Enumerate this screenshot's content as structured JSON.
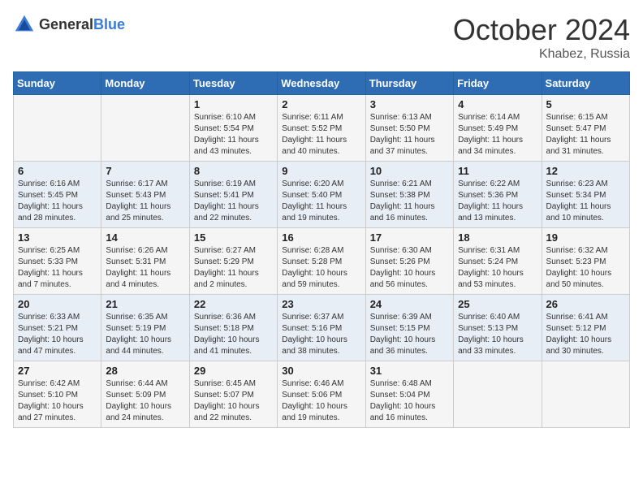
{
  "header": {
    "logo_general": "General",
    "logo_blue": "Blue",
    "month": "October 2024",
    "location": "Khabez, Russia"
  },
  "days_of_week": [
    "Sunday",
    "Monday",
    "Tuesday",
    "Wednesday",
    "Thursday",
    "Friday",
    "Saturday"
  ],
  "weeks": [
    [
      {
        "date": "",
        "info": ""
      },
      {
        "date": "",
        "info": ""
      },
      {
        "date": "1",
        "info": "Sunrise: 6:10 AM\nSunset: 5:54 PM\nDaylight: 11 hours and 43 minutes."
      },
      {
        "date": "2",
        "info": "Sunrise: 6:11 AM\nSunset: 5:52 PM\nDaylight: 11 hours and 40 minutes."
      },
      {
        "date": "3",
        "info": "Sunrise: 6:13 AM\nSunset: 5:50 PM\nDaylight: 11 hours and 37 minutes."
      },
      {
        "date": "4",
        "info": "Sunrise: 6:14 AM\nSunset: 5:49 PM\nDaylight: 11 hours and 34 minutes."
      },
      {
        "date": "5",
        "info": "Sunrise: 6:15 AM\nSunset: 5:47 PM\nDaylight: 11 hours and 31 minutes."
      }
    ],
    [
      {
        "date": "6",
        "info": "Sunrise: 6:16 AM\nSunset: 5:45 PM\nDaylight: 11 hours and 28 minutes."
      },
      {
        "date": "7",
        "info": "Sunrise: 6:17 AM\nSunset: 5:43 PM\nDaylight: 11 hours and 25 minutes."
      },
      {
        "date": "8",
        "info": "Sunrise: 6:19 AM\nSunset: 5:41 PM\nDaylight: 11 hours and 22 minutes."
      },
      {
        "date": "9",
        "info": "Sunrise: 6:20 AM\nSunset: 5:40 PM\nDaylight: 11 hours and 19 minutes."
      },
      {
        "date": "10",
        "info": "Sunrise: 6:21 AM\nSunset: 5:38 PM\nDaylight: 11 hours and 16 minutes."
      },
      {
        "date": "11",
        "info": "Sunrise: 6:22 AM\nSunset: 5:36 PM\nDaylight: 11 hours and 13 minutes."
      },
      {
        "date": "12",
        "info": "Sunrise: 6:23 AM\nSunset: 5:34 PM\nDaylight: 11 hours and 10 minutes."
      }
    ],
    [
      {
        "date": "13",
        "info": "Sunrise: 6:25 AM\nSunset: 5:33 PM\nDaylight: 11 hours and 7 minutes."
      },
      {
        "date": "14",
        "info": "Sunrise: 6:26 AM\nSunset: 5:31 PM\nDaylight: 11 hours and 4 minutes."
      },
      {
        "date": "15",
        "info": "Sunrise: 6:27 AM\nSunset: 5:29 PM\nDaylight: 11 hours and 2 minutes."
      },
      {
        "date": "16",
        "info": "Sunrise: 6:28 AM\nSunset: 5:28 PM\nDaylight: 10 hours and 59 minutes."
      },
      {
        "date": "17",
        "info": "Sunrise: 6:30 AM\nSunset: 5:26 PM\nDaylight: 10 hours and 56 minutes."
      },
      {
        "date": "18",
        "info": "Sunrise: 6:31 AM\nSunset: 5:24 PM\nDaylight: 10 hours and 53 minutes."
      },
      {
        "date": "19",
        "info": "Sunrise: 6:32 AM\nSunset: 5:23 PM\nDaylight: 10 hours and 50 minutes."
      }
    ],
    [
      {
        "date": "20",
        "info": "Sunrise: 6:33 AM\nSunset: 5:21 PM\nDaylight: 10 hours and 47 minutes."
      },
      {
        "date": "21",
        "info": "Sunrise: 6:35 AM\nSunset: 5:19 PM\nDaylight: 10 hours and 44 minutes."
      },
      {
        "date": "22",
        "info": "Sunrise: 6:36 AM\nSunset: 5:18 PM\nDaylight: 10 hours and 41 minutes."
      },
      {
        "date": "23",
        "info": "Sunrise: 6:37 AM\nSunset: 5:16 PM\nDaylight: 10 hours and 38 minutes."
      },
      {
        "date": "24",
        "info": "Sunrise: 6:39 AM\nSunset: 5:15 PM\nDaylight: 10 hours and 36 minutes."
      },
      {
        "date": "25",
        "info": "Sunrise: 6:40 AM\nSunset: 5:13 PM\nDaylight: 10 hours and 33 minutes."
      },
      {
        "date": "26",
        "info": "Sunrise: 6:41 AM\nSunset: 5:12 PM\nDaylight: 10 hours and 30 minutes."
      }
    ],
    [
      {
        "date": "27",
        "info": "Sunrise: 6:42 AM\nSunset: 5:10 PM\nDaylight: 10 hours and 27 minutes."
      },
      {
        "date": "28",
        "info": "Sunrise: 6:44 AM\nSunset: 5:09 PM\nDaylight: 10 hours and 24 minutes."
      },
      {
        "date": "29",
        "info": "Sunrise: 6:45 AM\nSunset: 5:07 PM\nDaylight: 10 hours and 22 minutes."
      },
      {
        "date": "30",
        "info": "Sunrise: 6:46 AM\nSunset: 5:06 PM\nDaylight: 10 hours and 19 minutes."
      },
      {
        "date": "31",
        "info": "Sunrise: 6:48 AM\nSunset: 5:04 PM\nDaylight: 10 hours and 16 minutes."
      },
      {
        "date": "",
        "info": ""
      },
      {
        "date": "",
        "info": ""
      }
    ]
  ]
}
